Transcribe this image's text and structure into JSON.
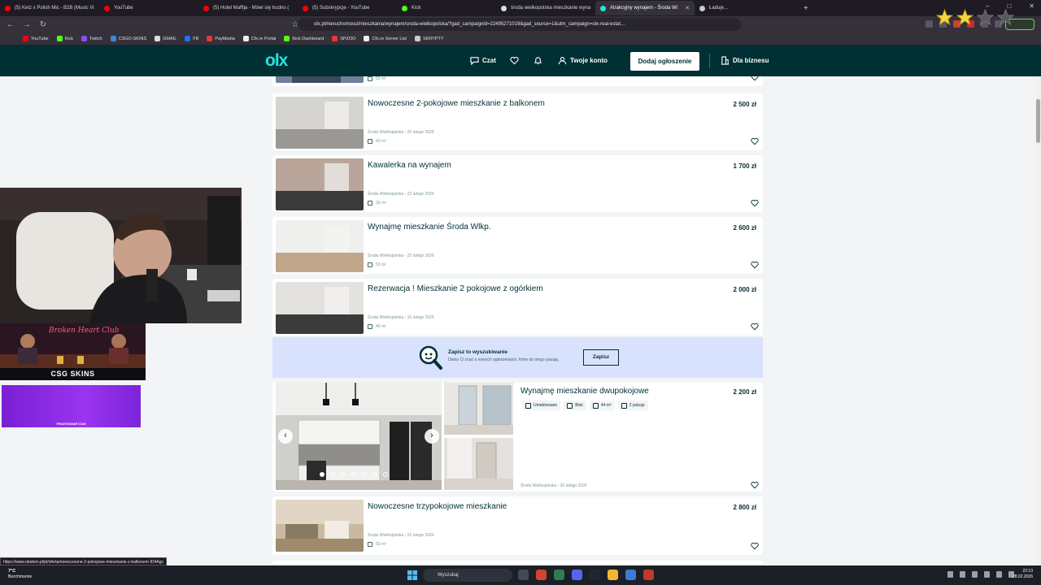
{
  "browser": {
    "tabs": [
      {
        "label": "(5) Ketz x Polish Mic - B2B (Music Vi",
        "color": "#ff0000",
        "active": false
      },
      {
        "label": "YouTube",
        "color": "#ff0000",
        "active": false
      },
      {
        "label": "(5) Hotel Maffija - Mówi się trudno (",
        "color": "#ff0000",
        "active": false
      },
      {
        "label": "(5) Subskrypcje - YouTube",
        "color": "#ff0000",
        "active": false
      },
      {
        "label": "Kick",
        "color": "#53fc18",
        "active": false
      },
      {
        "label": "środa wielkopolska mieszkanie wyna",
        "color": "#dddddd",
        "active": false
      },
      {
        "label": "Atrakcyjny wynajem - Środa Wi",
        "color": "#23e5db",
        "active": true
      },
      {
        "label": "Ładuje...",
        "color": "#cccccc",
        "active": false
      }
    ],
    "new_tab": "+",
    "url": "olx.pl/nieruchomosci/mieszkania/wynajem/sroda-wielkopolska/?gad_campaignid=22495271019&gad_source=1&utm_campaign=olx-real-estat...",
    "bookmarks": [
      {
        "label": "YouTube",
        "color": "#ff0000"
      },
      {
        "label": "Kick",
        "color": "#53fc18"
      },
      {
        "label": "Twitch",
        "color": "#9146ff"
      },
      {
        "label": "CSGO-SKINS",
        "color": "#3a8bd6"
      },
      {
        "label": "GMAIL",
        "color": "#dddddd"
      },
      {
        "label": "FB",
        "color": "#1877f2"
      },
      {
        "label": "PayMedia",
        "color": "#e53935"
      },
      {
        "label": "Cfx.re Portal",
        "color": "#eeeeee"
      },
      {
        "label": "Kick Dashboard",
        "color": "#53fc18"
      },
      {
        "label": "SPZOO",
        "color": "#e53935"
      },
      {
        "label": "Cfx.re Server List",
        "color": "#eeeeee"
      },
      {
        "label": "SKRYPTY",
        "color": "#cccccc"
      }
    ]
  },
  "header": {
    "logo": "olx",
    "chat": "Czat",
    "account": "Twoje konto",
    "add_button": "Dodaj ogłoszenie",
    "business": "Dla biznesu"
  },
  "listings": [
    {
      "title": "",
      "price": "",
      "location": "",
      "area": "83 m²",
      "partial": true
    },
    {
      "title": "Nowoczesne 2-pokojowe mieszkanie z balkonem",
      "price": "2 500 zł",
      "location": "Środa Wielkopolska - 25 lutego 2026",
      "area": "43 m²"
    },
    {
      "title": "Kawalerka na wynajem",
      "price": "1 700 zł",
      "location": "Środa Wielkopolska - 23 lutego 2026",
      "area": "30 m²"
    },
    {
      "title": "Wynajmę mieszkanie Środa Wlkp.",
      "price": "2 600 zł",
      "location": "Środa Wielkopolska - 22 lutego 2026",
      "area": "53 m²"
    },
    {
      "title": "Rezerwacja ! Mieszkanie 2 pokojowe z ogórkiem",
      "price": "2 000 zł",
      "location": "Środa Wielkopolska - 16 lutego 2026",
      "area": "46 m²"
    }
  ],
  "save_search": {
    "title": "Zapisz to wyszukiwanie",
    "subtitle": "Damy Ci znać o nowych ogłoszeniach, które do niego pasują.",
    "button": "Zapisz"
  },
  "featured": {
    "title": "Wynajmę mieszkanie dwupokojowe",
    "price": "2 200 zł",
    "tags": [
      "Umeblowane",
      "Blok",
      "44 m²",
      "2 pokoje"
    ],
    "location": "Środa Wielkopolska - 20 lutego 2026",
    "slide_count": 7,
    "active_slide": 1
  },
  "listing_after": {
    "title": "Nowoczesne trzypokojowe mieszkanie",
    "price": "2 800 zł",
    "location": "Środa Wielkopolska - 22 lutego 2026",
    "area": "63 m²"
  },
  "overlays": {
    "club": "Broken Heart Club",
    "csg": "CSG SKINS",
    "pirate": "PIRATESWAP.COM"
  },
  "status_url": "https://www.otodom.pl/pl/oferta/nowoczesne-2-pokojowe-mieszkanie-z-balkonem-ID4Agc",
  "taskbar": {
    "temp": "7°C",
    "weather": "Bezchmurnie",
    "search": "Wyszukaj",
    "time": "22:13",
    "date": "28.02.2026"
  },
  "colors": {
    "olx_dark": "#002f34",
    "olx_teal": "#23e5db",
    "save_bg": "#d8e2fc"
  }
}
